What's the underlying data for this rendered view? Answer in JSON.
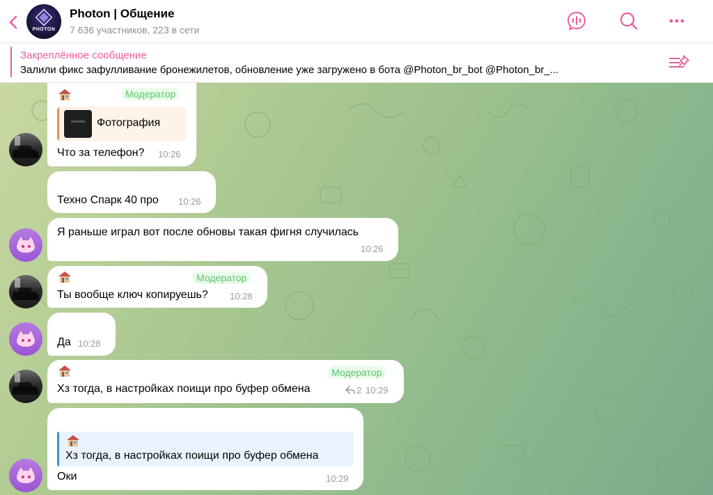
{
  "header": {
    "title": "Photon | Общение",
    "subtitle": "7 636 участников, 223 в сети",
    "avatar_text": "PHOTON",
    "accent": "#e95d9a"
  },
  "pinned": {
    "title": "Закреплённое сообщение",
    "text": "Залили фикс зафулливание бронежилетов, обновление уже загружено в бота  @Photon_br_bot @Photon_br_..."
  },
  "messages": [
    {
      "sender_badge": "Модератор",
      "reply_preview": "Фотография",
      "text": "Что за телефон?",
      "time": "10:26"
    },
    {
      "text": "Техно Спарк 40 про",
      "time": "10:26"
    },
    {
      "text": "Я раньше играл вот после обновы такая фигня случилась",
      "time": "10:26"
    },
    {
      "sender_badge": "Модератор",
      "text": "Ты вообще ключ копируешь?",
      "time": "10:28"
    },
    {
      "text": "Да",
      "time": "10:28"
    },
    {
      "sender_badge": "Модератор",
      "text": "Хз тогда, в настройках поищи про буфер обмена",
      "reply_count": "2",
      "time": "10:29"
    },
    {
      "quote": "Хз тогда, в настройках поищи про буфер обмена",
      "text": "Оки",
      "time": "10:29"
    }
  ]
}
